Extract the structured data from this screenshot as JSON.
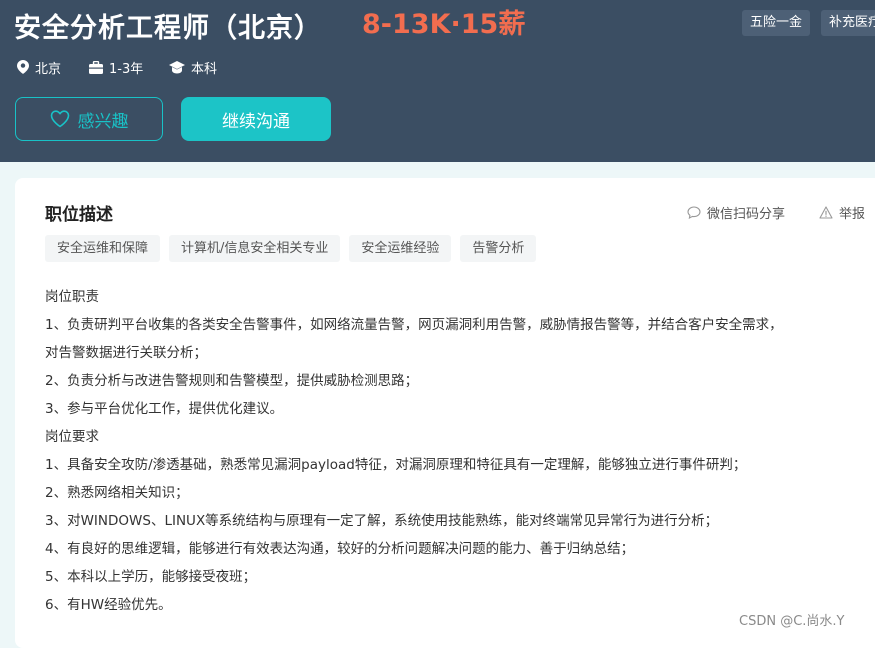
{
  "header": {
    "title": "安全分析工程师（北京）",
    "salary": "8-13K·15薪",
    "benefits": [
      "五险一金",
      "补充医疗"
    ],
    "meta": {
      "location": "北京",
      "experience": "1-3年",
      "degree": "本科"
    },
    "interest_label": "感兴趣",
    "chat_label": "继续沟通"
  },
  "job": {
    "section_title": "职位描述",
    "share_label": "微信扫码分享",
    "report_label": "举报",
    "tags": [
      "安全运维和保障",
      "计算机/信息安全相关专业",
      "安全运维经验",
      "告警分析"
    ],
    "description": [
      "岗位职责",
      "1、负责研判平台收集的各类安全告警事件，如网络流量告警，网页漏洞利用告警，威胁情报告警等，并结合客户安全需求，",
      "对告警数据进行关联分析；",
      "2、负责分析与改进告警规则和告警模型，提供威胁检测思路；",
      "3、参与平台优化工作，提供优化建议。",
      "岗位要求",
      "1、具备安全攻防/渗透基础，熟悉常见漏洞payload特征，对漏洞原理和特征具有一定理解，能够独立进行事件研判；",
      "2、熟悉网络相关知识；",
      "3、对WINDOWS、LINUX等系统结构与原理有一定了解，系统使用技能熟练，能对终端常见异常行为进行分析；",
      "4、有良好的思维逻辑，能够进行有效表达沟通，较好的分析问题解决问题的能力、善于归纳总结；",
      "5、本科以上学历，能够接受夜班；",
      "6、有HW经验优先。"
    ]
  },
  "watermark": "CSDN @C.尚水.Y",
  "colors": {
    "header_bg": "#3b4e63",
    "salary": "#f26d4f",
    "accent": "#1cc4c7"
  }
}
